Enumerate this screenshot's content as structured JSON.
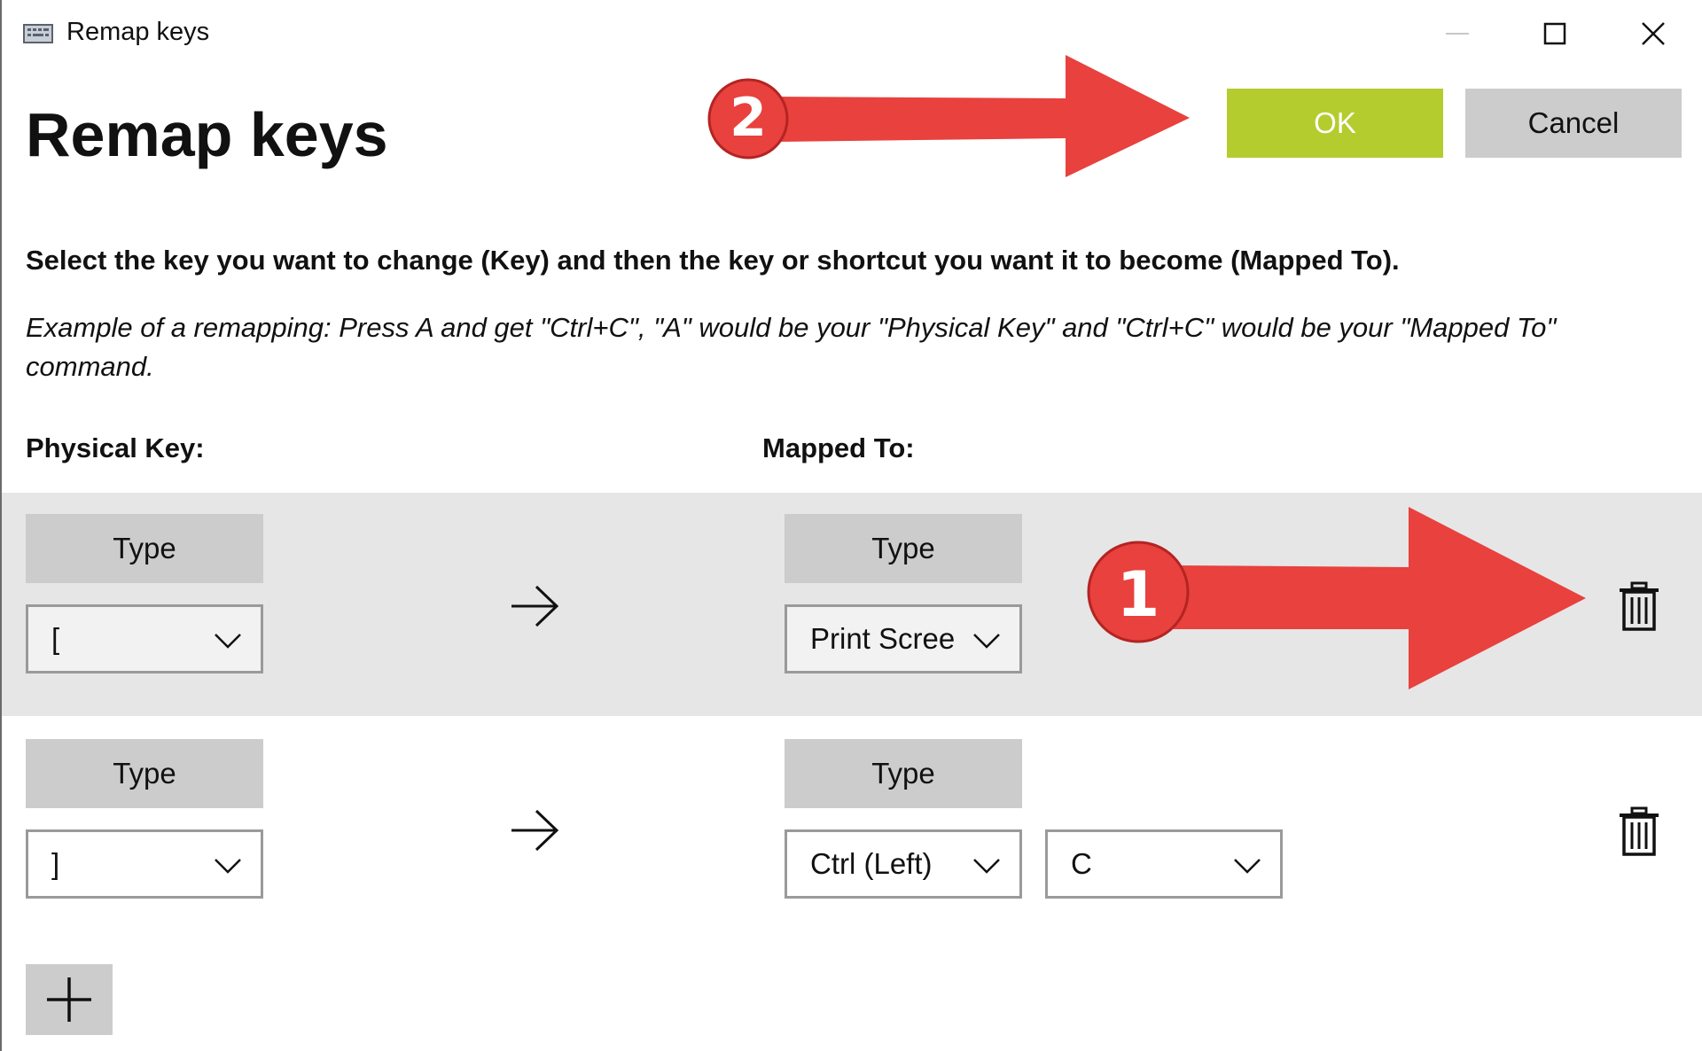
{
  "window": {
    "title": "Remap keys",
    "controls": [
      "minimize-icon",
      "maximize-icon",
      "close-icon"
    ]
  },
  "page": {
    "title": "Remap keys",
    "ok_label": "OK",
    "cancel_label": "Cancel",
    "instructions": "Select the key you want to change (Key) and then the key or shortcut you want it to become (Mapped To).",
    "example_line1": "Example of a remapping: Press A and get \"Ctrl+C\", \"A\" would be your \"Physical Key\" and \"Ctrl+C\" would be your \"Mapped To\"",
    "example_line2": "command.",
    "physical_header": "Physical Key:",
    "mapped_header": "Mapped To:"
  },
  "mappings": [
    {
      "physical_type_label": "Type",
      "physical_key": "[",
      "mapped_type_label": "Type",
      "mapped_keys": [
        "Print Scree"
      ],
      "highlighted": true
    },
    {
      "physical_type_label": "Type",
      "physical_key": "]",
      "mapped_type_label": "Type",
      "mapped_keys": [
        "Ctrl (Left)",
        "C"
      ],
      "highlighted": false
    }
  ],
  "annotations": [
    {
      "number": "1",
      "color": "#e8413e"
    },
    {
      "number": "2",
      "color": "#e8413e"
    }
  ],
  "colors": {
    "ok_accent": "#b5cc2e",
    "button_gray": "#cccccc",
    "annotation_red": "#e8413e"
  }
}
